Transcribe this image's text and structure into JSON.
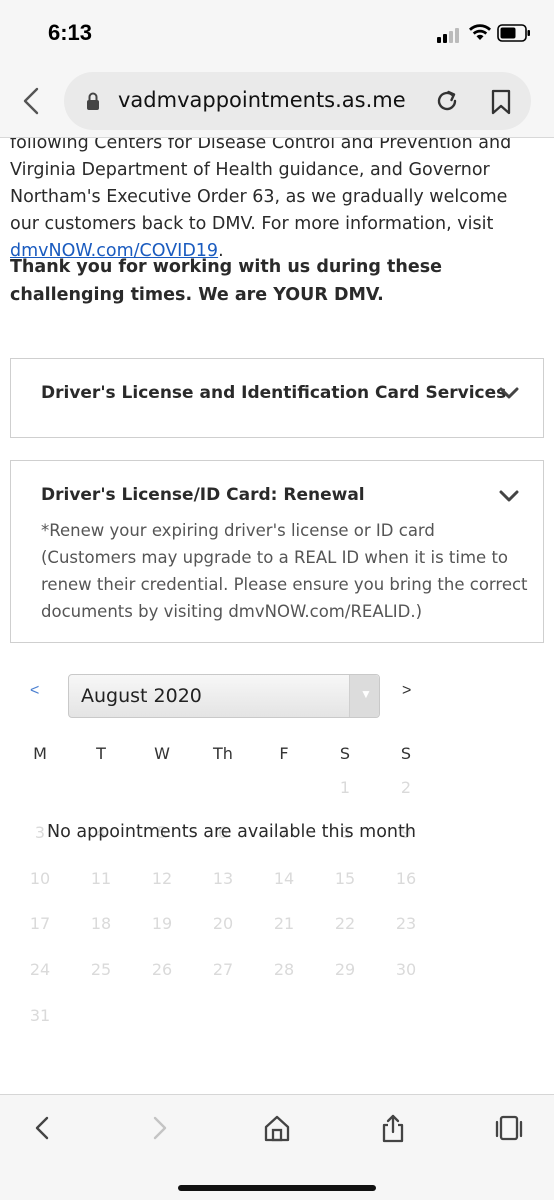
{
  "status_bar": {
    "time": "6:13"
  },
  "browser": {
    "url": "vadmvappointments.as.me"
  },
  "content": {
    "intro_text": "following Centers for Disease Control and Prevention and Virginia Department of Health guidance, and Governor Northam's Executive Order 63, as we gradually welcome our customers back to DMV. For more information, visit ",
    "intro_link": "dmvNOW.com/COVID19",
    "intro_end": ".",
    "thanks": "Thank you for working with us during these challenging times. We are YOUR DMV."
  },
  "accordions": [
    {
      "title": "Driver's License and Identification Card Services"
    },
    {
      "title": "Driver's License/ID Card: Renewal",
      "description": "*Renew your expiring driver's license or ID card (Customers may upgrade to a REAL ID when it is time to renew their credential. Please ensure you bring the correct documents by visiting dmvNOW.com/REALID.)"
    }
  ],
  "calendar": {
    "prev_label": "<",
    "next_label": ">",
    "month": "August 2020",
    "weekdays": [
      "M",
      "T",
      "W",
      "Th",
      "F",
      "S",
      "S"
    ],
    "weeks": [
      [
        "",
        "",
        "",
        "",
        "",
        "1",
        "2"
      ],
      [
        "3",
        "4",
        "5",
        "6",
        "7",
        "8",
        "9"
      ],
      [
        "10",
        "11",
        "12",
        "13",
        "14",
        "15",
        "16"
      ],
      [
        "17",
        "18",
        "19",
        "20",
        "21",
        "22",
        "23"
      ],
      [
        "24",
        "25",
        "26",
        "27",
        "28",
        "29",
        "30"
      ],
      [
        "31",
        "",
        "",
        "",
        "",
        "",
        ""
      ]
    ],
    "empty_message": "No appointments are available this month"
  },
  "toolbar": {
    "icons": [
      "back-icon",
      "forward-icon",
      "home-icon",
      "share-icon",
      "tabs-icon"
    ]
  },
  "colors": {
    "link": "#1a5bbf",
    "text": "#2a2a2a",
    "muted_day": "#dadada"
  }
}
